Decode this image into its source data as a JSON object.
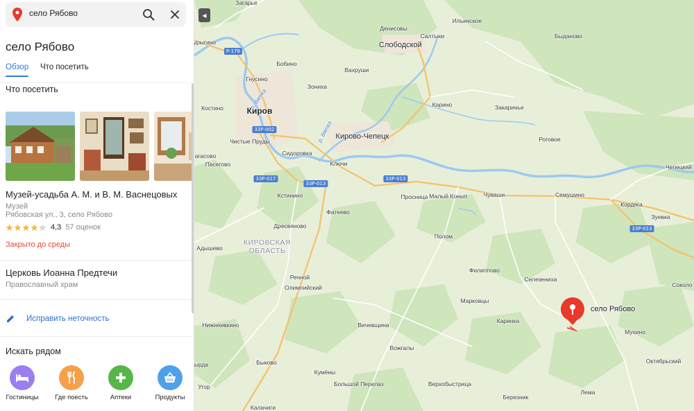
{
  "search": {
    "query": "село Рябово",
    "pin_icon": "location-pin-icon",
    "search_icon": "search-icon",
    "close_icon": "close-icon"
  },
  "place": {
    "title": "село Рябово"
  },
  "tabs": [
    {
      "label": "Обзор",
      "active": true
    },
    {
      "label": "Что посетить",
      "active": false
    }
  ],
  "visit_section": {
    "title": "Что посетить",
    "items": [
      {
        "name": "Музей-усадьба А. М. и В. М. Васнецовых",
        "type": "Музей",
        "address": "Рябовская ул., 3, село Рябово",
        "rating": "4,3",
        "rating_stars_value": 4.3,
        "reviews": "57 оценок",
        "status": "Закрыто до среды"
      },
      {
        "name": "Церковь Иоанна Предтечи",
        "type": "Православный храм"
      }
    ]
  },
  "fix": {
    "label": "Исправить неточность",
    "icon": "pencil-icon"
  },
  "nearby": {
    "title": "Искать рядом",
    "categories": [
      {
        "label": "Гостиницы",
        "icon": "bed-icon",
        "color": "#9b7ef0"
      },
      {
        "label": "Где поесть",
        "icon": "fork-knife-icon",
        "color": "#f5a04a"
      },
      {
        "label": "Аптеки",
        "icon": "plus-icon",
        "color": "#57b649"
      },
      {
        "label": "Продукты",
        "icon": "basket-icon",
        "color": "#4fa0ea"
      }
    ]
  },
  "colors": {
    "accent": "#2e7ae0",
    "closed": "#e04a36",
    "pin": "#e8392b",
    "map_bg": "#e8efd9",
    "forest": "#cfe5bc",
    "water": "#9cc9ef",
    "road_federal": "#f4c26c"
  },
  "map": {
    "selected_label": "село Рябово",
    "region_label": [
      "КИРОВСКАЯ",
      "ОБЛАСТЬ"
    ],
    "shields": [
      "Р-176",
      "33Р-002",
      "33Р-017",
      "33Р-013",
      "33Р-013",
      "33Р-013"
    ],
    "rivers": [
      "р. Вятка",
      "р. Вятка"
    ],
    "places": {
      "big": [
        "Киров",
        "Слободской",
        "Кирово-Чепецк"
      ],
      "small": [
        "Загарье",
        "Денисовы",
        "Ильинское",
        "Салтыки",
        "Быданово",
        "урыгино",
        "Бобино",
        "Гнусино",
        "Вахруши",
        "Зониха",
        "Костино",
        "Карино",
        "Закаринье",
        "Чистые Пруды",
        "Сидоровка",
        "Роговое",
        "агасово",
        "Пасегово",
        "Ключи",
        "Чепецкий",
        "Кстинино",
        "Просница",
        "Малый Конып",
        "Чуваши",
        "Семушино",
        "Кордяга",
        "Зуевка",
        "Фатеево",
        "Дресвяново",
        "Полом",
        "Адышево",
        "Филиппово",
        "Селезениха",
        "Речной",
        "Соколо",
        "Олимпийский",
        "Марковцы",
        "Каринка",
        "Нижнеивкино",
        "Вичевщина",
        "Мухино",
        "Вожгалы",
        "Октябрьский",
        "ырда",
        "Быково",
        "Кумёны",
        "Угор",
        "Большой Перелаз",
        "Верхобыстрица",
        "Лема",
        "Березник",
        "Калачиги"
      ]
    }
  }
}
